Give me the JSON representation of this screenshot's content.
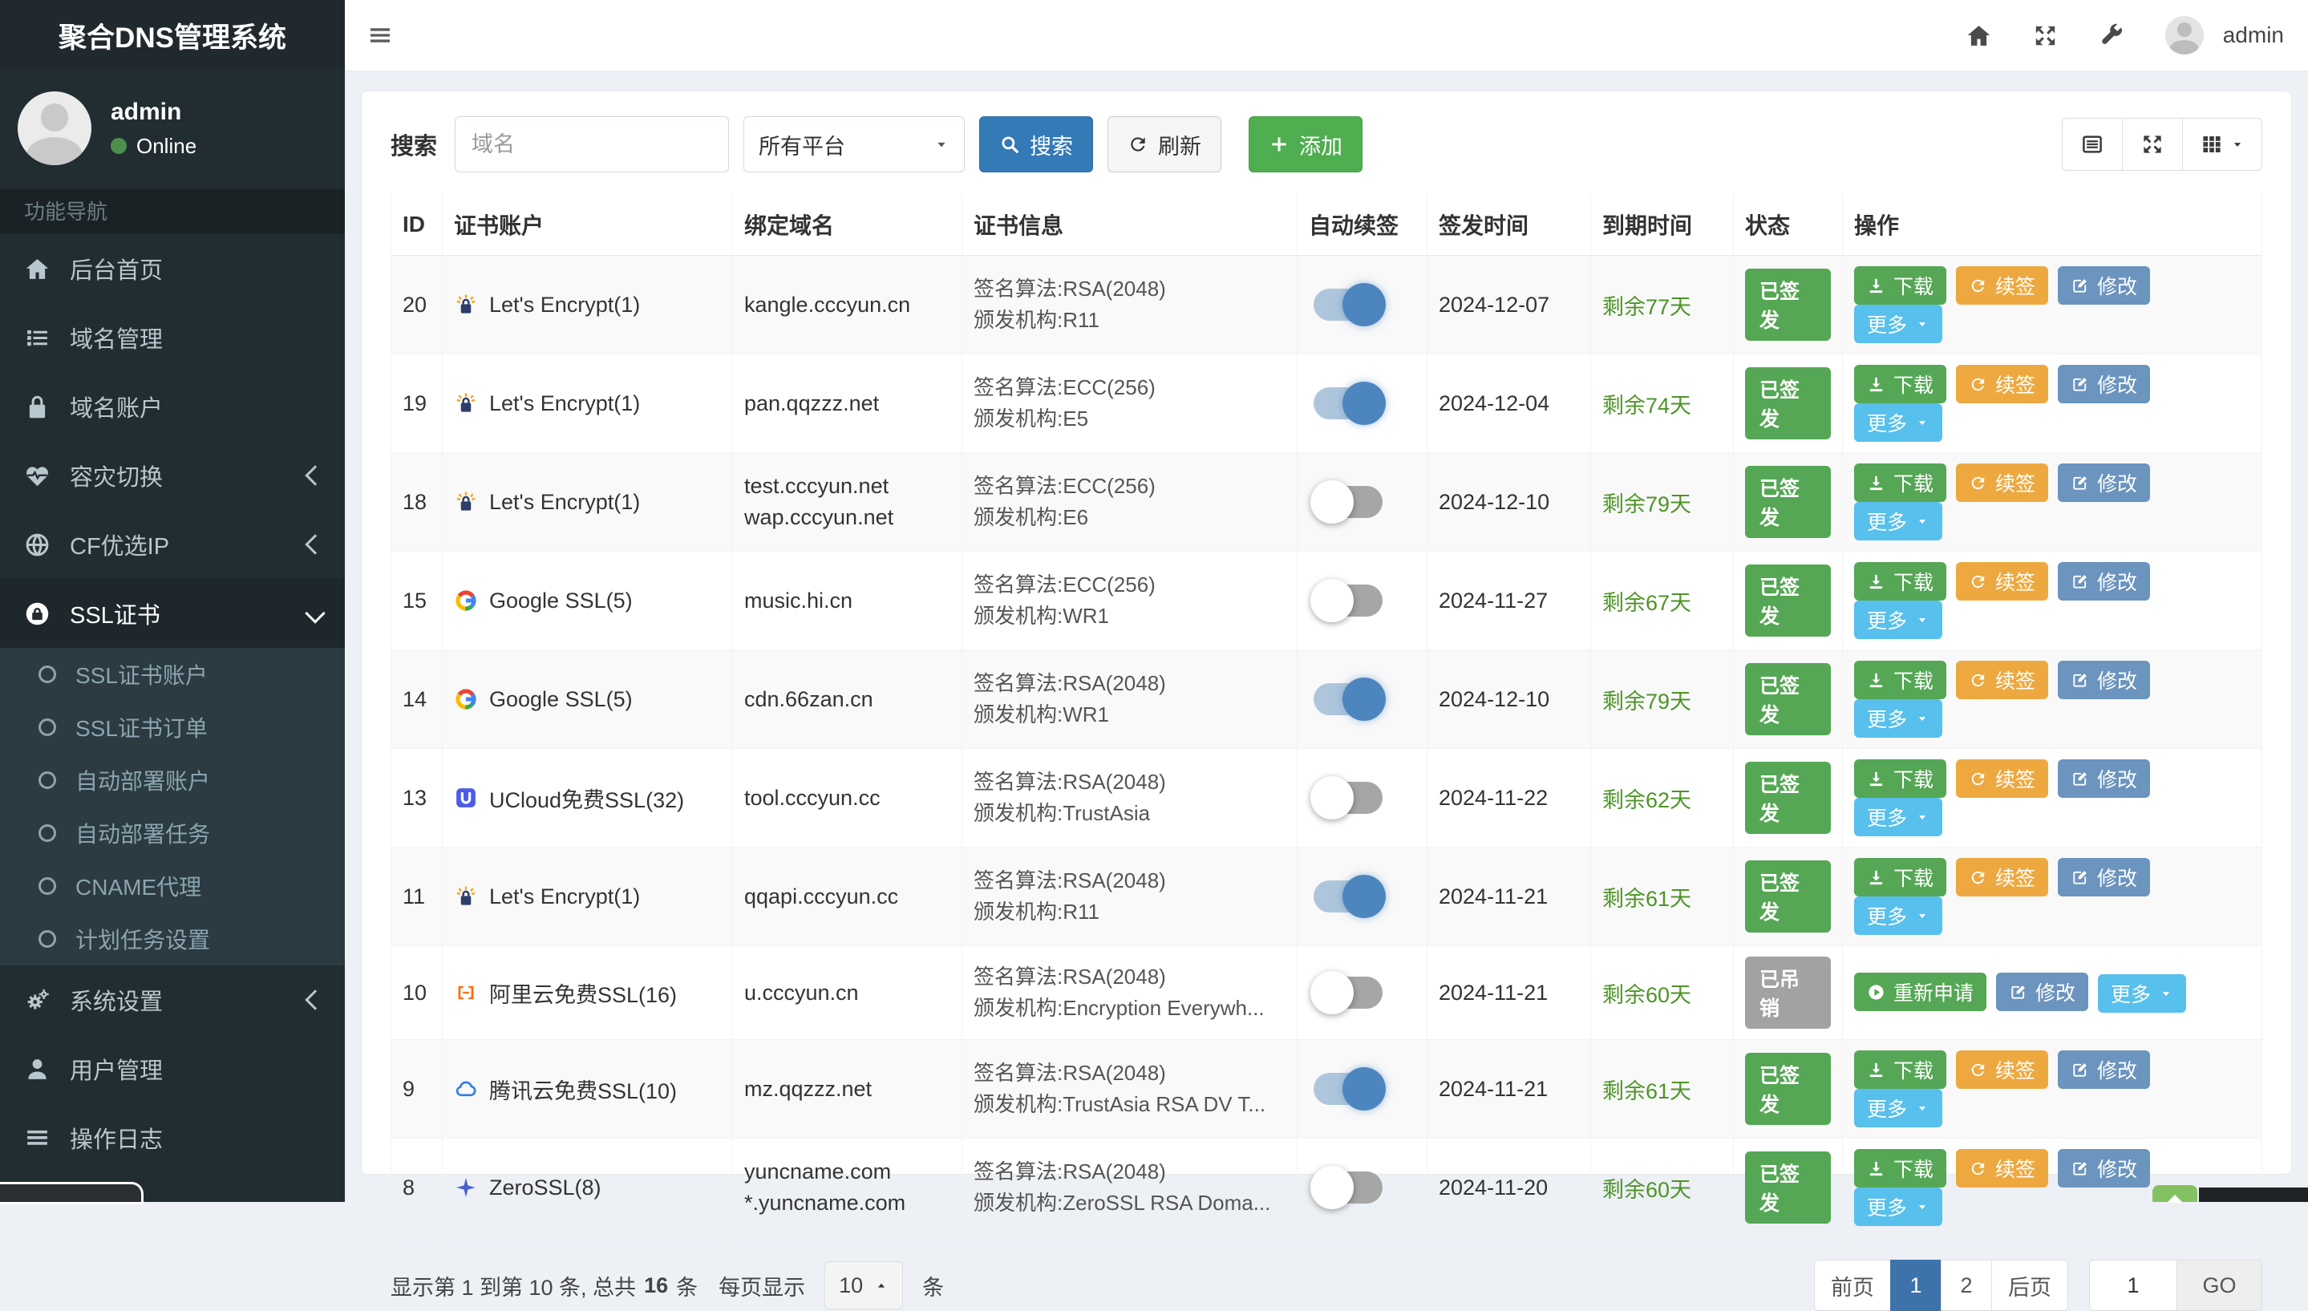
{
  "brand": "聚合DNS管理系统",
  "navbar": {
    "username": "admin"
  },
  "user_panel": {
    "name": "admin",
    "status": "Online",
    "status_color": "#4b8f4b"
  },
  "sidebar": {
    "section_label": "功能导航",
    "items": [
      {
        "label": "后台首页",
        "icon": "home"
      },
      {
        "label": "域名管理",
        "icon": "list"
      },
      {
        "label": "域名账户",
        "icon": "lock"
      },
      {
        "label": "容灾切换",
        "icon": "heartbeat",
        "arrow": "left"
      },
      {
        "label": "CF优选IP",
        "icon": "globe",
        "arrow": "left"
      },
      {
        "label": "SSL证书",
        "icon": "ssl",
        "arrow": "down",
        "active": true,
        "children": [
          {
            "label": "SSL证书账户"
          },
          {
            "label": "SSL证书订单"
          },
          {
            "label": "自动部署账户"
          },
          {
            "label": "自动部署任务"
          },
          {
            "label": "CNAME代理"
          },
          {
            "label": "计划任务设置"
          }
        ]
      },
      {
        "label": "系统设置",
        "icon": "gears",
        "arrow": "left"
      },
      {
        "label": "用户管理",
        "icon": "user"
      },
      {
        "label": "操作日志",
        "icon": "log"
      }
    ]
  },
  "toolbar": {
    "search_label": "搜索",
    "domain_placeholder": "域名",
    "platform_value": "所有平台",
    "search_button": "搜索",
    "refresh_button": "刷新",
    "add_button": "添加"
  },
  "table": {
    "columns": [
      "ID",
      "证书账户",
      "绑定域名",
      "证书信息",
      "自动续签",
      "签发时间",
      "到期时间",
      "状态",
      "操作"
    ],
    "cert_labels": {
      "algo": "签名算法:",
      "issuer": "颁发机构:"
    },
    "rows": [
      {
        "id": "20",
        "account": "Let's Encrypt(1)",
        "account_icon": "letsencrypt",
        "domains": [
          "kangle.cccyun.cn"
        ],
        "algo": "RSA(2048)",
        "issuer": "R11",
        "auto_renew": true,
        "issued": "2024-12-07",
        "expire": "剩余77天",
        "status": "已签发",
        "status_type": "issued",
        "actions": "normal"
      },
      {
        "id": "19",
        "account": "Let's Encrypt(1)",
        "account_icon": "letsencrypt",
        "domains": [
          "pan.qqzzz.net"
        ],
        "algo": "ECC(256)",
        "issuer": "E5",
        "auto_renew": true,
        "issued": "2024-12-04",
        "expire": "剩余74天",
        "status": "已签发",
        "status_type": "issued",
        "actions": "normal"
      },
      {
        "id": "18",
        "account": "Let's Encrypt(1)",
        "account_icon": "letsencrypt",
        "domains": [
          "test.cccyun.net",
          "wap.cccyun.net"
        ],
        "algo": "ECC(256)",
        "issuer": "E6",
        "auto_renew": false,
        "issued": "2024-12-10",
        "expire": "剩余79天",
        "status": "已签发",
        "status_type": "issued",
        "actions": "normal"
      },
      {
        "id": "15",
        "account": "Google SSL(5)",
        "account_icon": "google",
        "domains": [
          "music.hi.cn"
        ],
        "algo": "ECC(256)",
        "issuer": "WR1",
        "auto_renew": false,
        "issued": "2024-11-27",
        "expire": "剩余67天",
        "status": "已签发",
        "status_type": "issued",
        "actions": "normal"
      },
      {
        "id": "14",
        "account": "Google SSL(5)",
        "account_icon": "google",
        "domains": [
          "cdn.66zan.cn"
        ],
        "algo": "RSA(2048)",
        "issuer": "WR1",
        "auto_renew": true,
        "issued": "2024-12-10",
        "expire": "剩余79天",
        "status": "已签发",
        "status_type": "issued",
        "actions": "normal"
      },
      {
        "id": "13",
        "account": "UCloud免费SSL(32)",
        "account_icon": "ucloud",
        "domains": [
          "tool.cccyun.cc"
        ],
        "algo": "RSA(2048)",
        "issuer": "TrustAsia",
        "auto_renew": false,
        "issued": "2024-11-22",
        "expire": "剩余62天",
        "status": "已签发",
        "status_type": "issued",
        "actions": "normal"
      },
      {
        "id": "11",
        "account": "Let's Encrypt(1)",
        "account_icon": "letsencrypt",
        "domains": [
          "qqapi.cccyun.cc"
        ],
        "algo": "RSA(2048)",
        "issuer": "R11",
        "auto_renew": true,
        "issued": "2024-11-21",
        "expire": "剩余61天",
        "status": "已签发",
        "status_type": "issued",
        "actions": "normal"
      },
      {
        "id": "10",
        "account": "阿里云免费SSL(16)",
        "account_icon": "aliyun",
        "domains": [
          "u.cccyun.cn"
        ],
        "algo": "RSA(2048)",
        "issuer": "Encryption Everywh...",
        "auto_renew": false,
        "issued": "2024-11-21",
        "expire": "剩余60天",
        "status": "已吊销",
        "status_type": "revoked",
        "actions": "revoked"
      },
      {
        "id": "9",
        "account": "腾讯云免费SSL(10)",
        "account_icon": "tencent",
        "domains": [
          "mz.qqzzz.net"
        ],
        "algo": "RSA(2048)",
        "issuer": "TrustAsia RSA DV T...",
        "auto_renew": true,
        "issued": "2024-11-21",
        "expire": "剩余61天",
        "status": "已签发",
        "status_type": "issued",
        "actions": "normal"
      },
      {
        "id": "8",
        "account": "ZeroSSL(8)",
        "account_icon": "zerossl",
        "domains": [
          "yuncname.com",
          "*.yuncname.com"
        ],
        "algo": "RSA(2048)",
        "issuer": "ZeroSSL RSA Doma...",
        "auto_renew": false,
        "issued": "2024-11-20",
        "expire": "剩余60天",
        "status": "已签发",
        "status_type": "issued",
        "actions": "normal"
      }
    ]
  },
  "actions_catalog": {
    "download": {
      "label": "下载",
      "icon": "i-download",
      "style": "g"
    },
    "renew": {
      "label": "续签",
      "icon": "i-refresh",
      "style": "o"
    },
    "edit": {
      "label": "修改",
      "icon": "i-edit",
      "style": "s"
    },
    "more": {
      "label": "更多",
      "icon": "i-caret-d",
      "style": "k",
      "caret_after": true
    },
    "reapply": {
      "label": "重新申请",
      "icon": "i-play",
      "style": "g"
    }
  },
  "action_sets": {
    "normal": [
      "download",
      "renew",
      "edit",
      "more"
    ],
    "revoked": [
      "reapply",
      "edit",
      "more"
    ]
  },
  "pagination": {
    "info_prefix": "显示第 1 到第 10 条, 总共",
    "total": "16",
    "info_suffix": "条",
    "per_page_label": "每页显示",
    "per_page": "10",
    "per_page_suffix": "条",
    "prev": "前页",
    "pages": [
      "1",
      "2"
    ],
    "active_page": "1",
    "next": "后页",
    "goto_value": "1",
    "go": "GO"
  },
  "colors": {
    "accent_blue": "#337ab7",
    "success_green": "#55a755",
    "warn_orange": "#eda940",
    "edit_steel": "#6b94be",
    "info_sky": "#58c0ec",
    "sidebar_bg": "#222d32"
  }
}
